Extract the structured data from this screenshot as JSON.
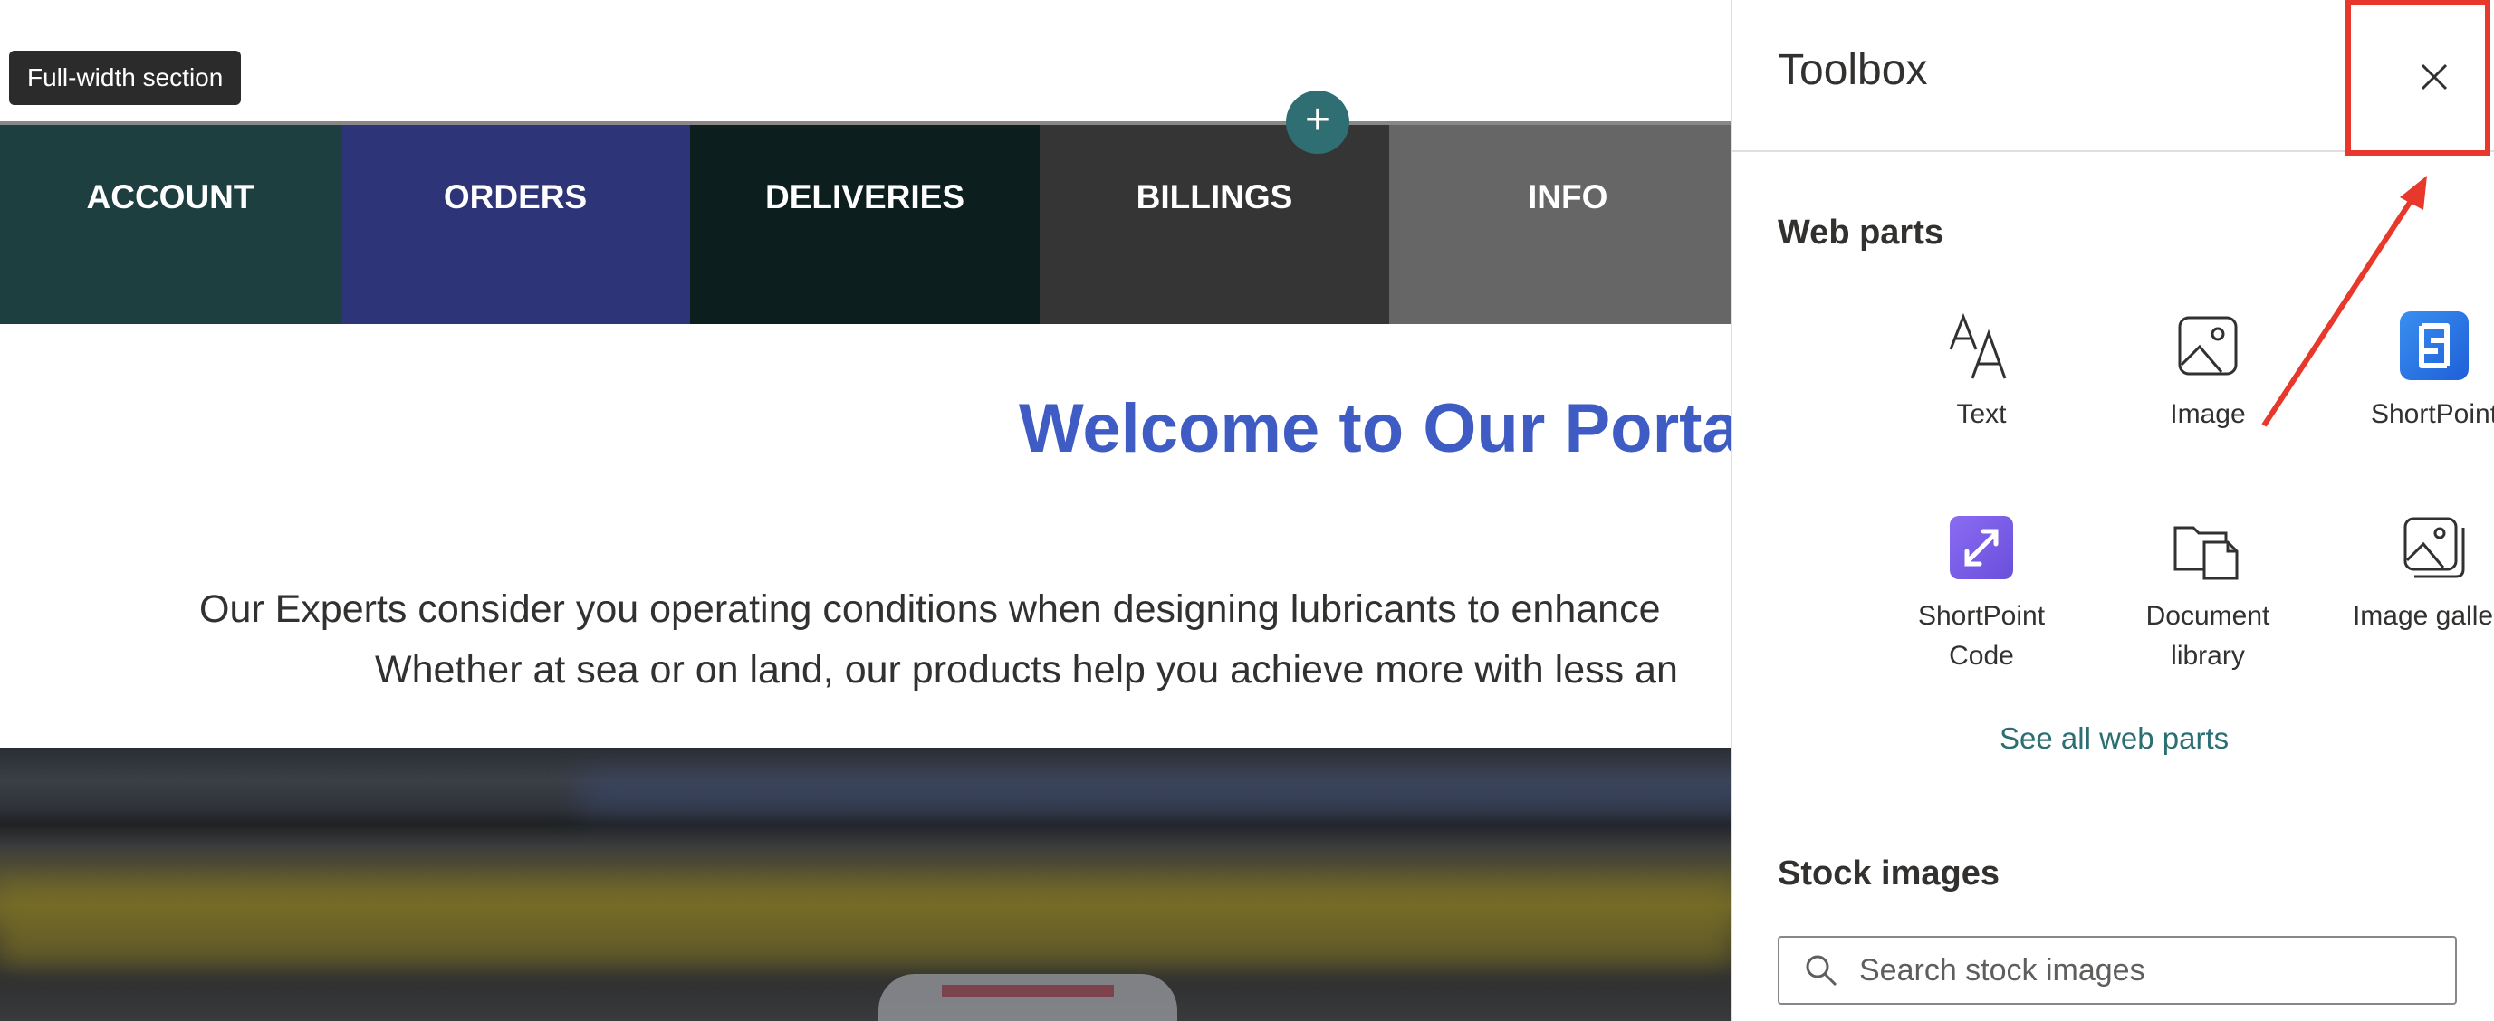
{
  "canvas": {
    "section_tag": "Full-width section",
    "nav": [
      {
        "label": "ACCOUNT",
        "color": "#1d3f3f"
      },
      {
        "label": "ORDERS",
        "color": "#2d3578"
      },
      {
        "label": "DELIVERIES",
        "color": "#0d1e1f"
      },
      {
        "label": "BILLINGS",
        "color": "#353535"
      },
      {
        "label": "INFO",
        "color": "#666666"
      }
    ],
    "welcome": "Welcome to Our Porta",
    "paragraph": {
      "line1": "Our Experts consider you operating conditions when designing lubricants to enhance",
      "line2": "Whether at sea or on land, our products help you achieve more with less an"
    }
  },
  "toolbox": {
    "title": "Toolbox",
    "close_icon": "close-icon",
    "web_parts": {
      "heading": "Web parts",
      "items": [
        {
          "label": "Text",
          "icon": "text-icon"
        },
        {
          "label": "Image",
          "icon": "image-icon"
        },
        {
          "label": "ShortPoint",
          "icon": "shortpoint-icon"
        },
        {
          "label": "ShortPoint Code",
          "icon": "shortpoint-code-icon"
        },
        {
          "label": "Document library",
          "icon": "document-library-icon"
        },
        {
          "label": "Image gallery",
          "icon": "image-gallery-icon"
        }
      ],
      "see_all": "See all web parts"
    },
    "stock_images": {
      "heading": "Stock images",
      "search_placeholder": "Search stock images"
    }
  },
  "colors": {
    "accent": "#2b6f73",
    "welcome": "#3f5bc4",
    "highlight": "#e8382b"
  }
}
